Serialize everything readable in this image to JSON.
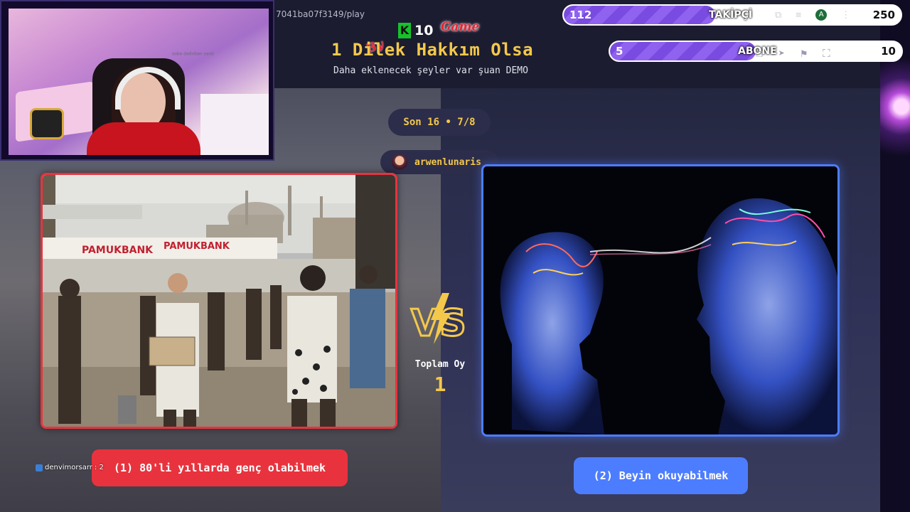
{
  "browser": {
    "url_fragment": "7041ba07f3149/play"
  },
  "logo": {
    "k": "K",
    "number": "10",
    "game": "Game",
    "by": "By"
  },
  "header": {
    "title": "1 Dilek Hakkım Olsa",
    "subtitle": "Daha eklenecek şeyler var şuan DEMO"
  },
  "round": {
    "label": "Son 16 • 7/8"
  },
  "user": {
    "name": "arwenlunaris"
  },
  "followers": {
    "current": "112",
    "label": "TAKİPÇİ",
    "goal": "250",
    "fraction": 0.45
  },
  "subscribers": {
    "current": "5",
    "label": "ABONE",
    "goal": "10",
    "fraction": 0.5
  },
  "choices": {
    "left": {
      "label": "(1) 80'li yıllarda genç olabilmek",
      "color": "#e8333e",
      "image_sign_1": "PAMUKBANK",
      "image_sign_2": "PAMUKBANK"
    },
    "right": {
      "label": "(2) Beyin okuyabilmek",
      "color": "#4d7dff"
    }
  },
  "vs": {
    "text": "VS"
  },
  "votes": {
    "label": "Toplam Oy",
    "value": "1"
  },
  "chat": {
    "user": "denvimorsarr",
    "suffix": ": 2"
  },
  "webcam": {
    "caption": "ques uequpep eqos"
  },
  "icons": [
    "puzzle-icon",
    "playlist-icon",
    "account-icon",
    "kebab-menu-icon",
    "copy-icon",
    "send-icon",
    "flag-icon",
    "fullscreen-icon"
  ],
  "account_initial": "A",
  "colors": {
    "accent_gold": "#f4c84a",
    "left_red": "#e8333e",
    "right_blue": "#4d7dff",
    "progress_purple": "#7a4be0"
  }
}
